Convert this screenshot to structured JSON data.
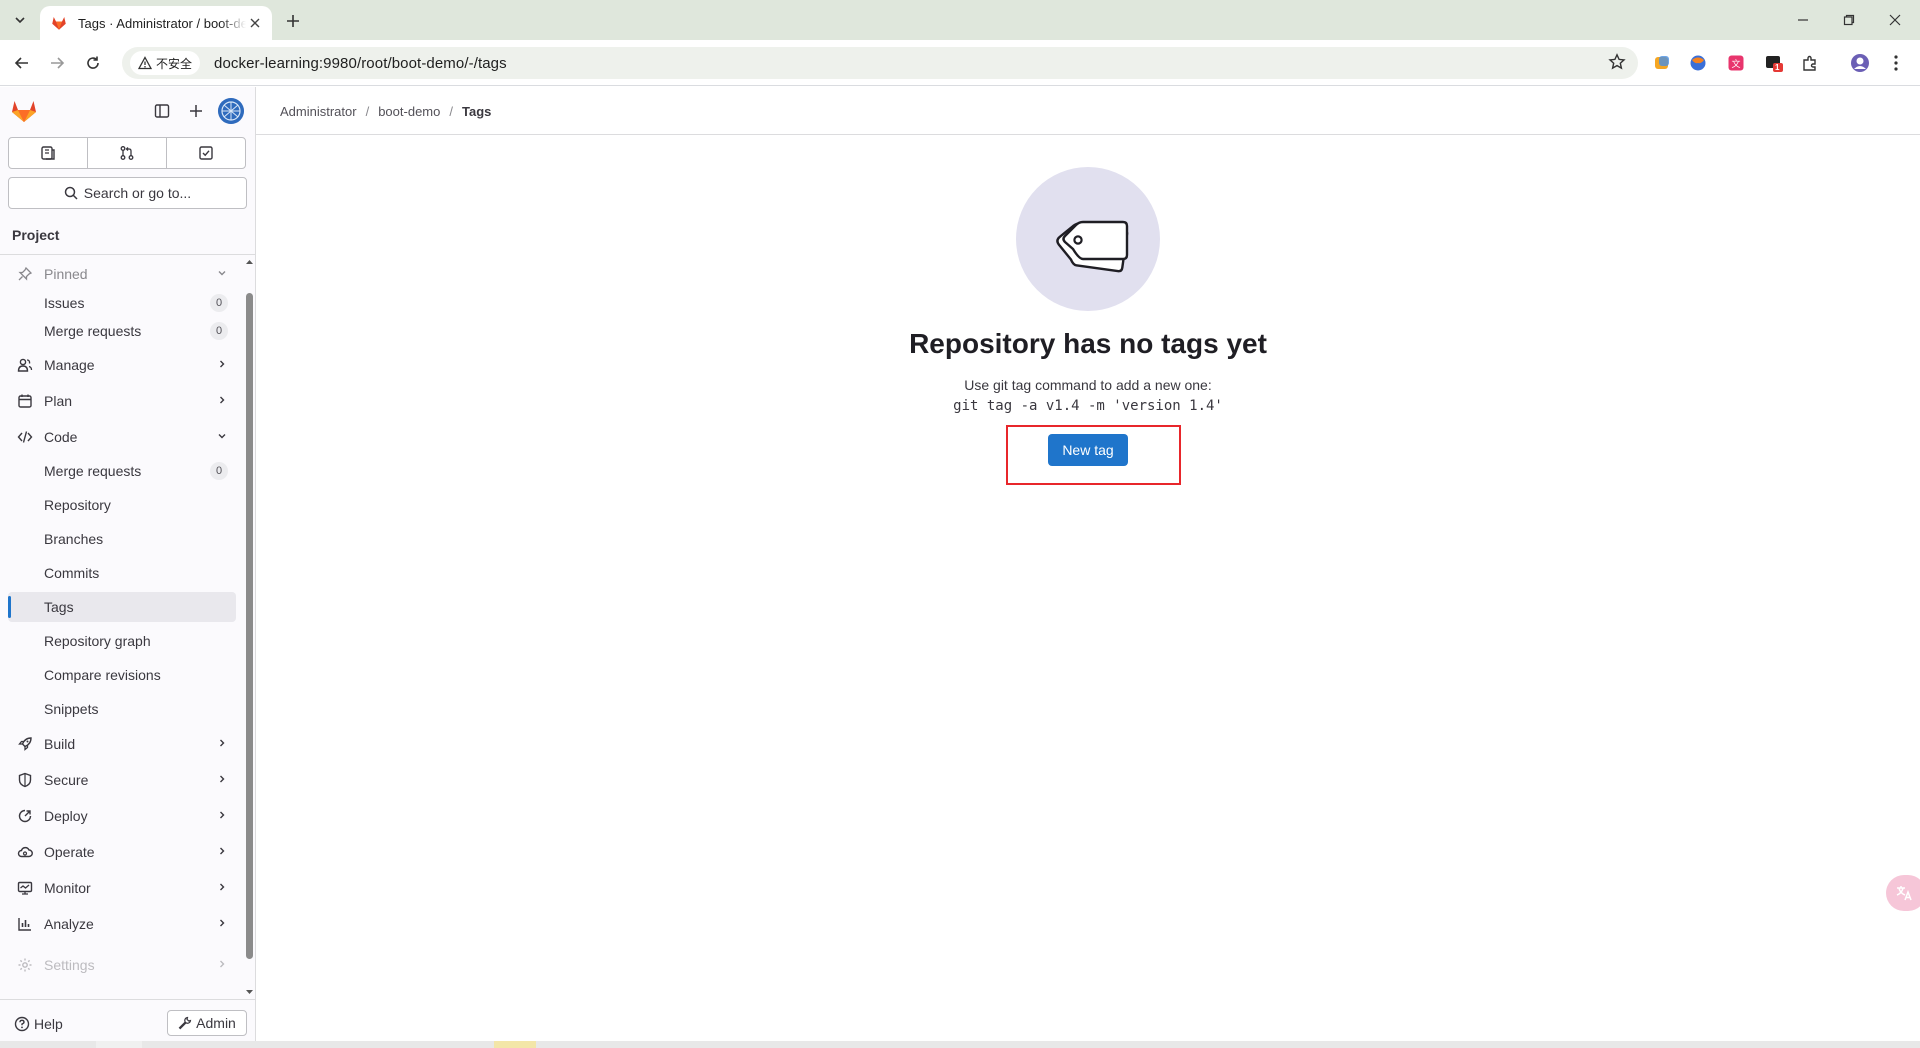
{
  "browser": {
    "tab_title": "Tags · Administrator / boot-demo · GitLab",
    "security_label": "不安全",
    "url": "docker-learning:9980/root/boot-demo/-/tags",
    "extension_badge": "1"
  },
  "sidebar": {
    "search_placeholder": "Search or go to...",
    "context_title": "Project",
    "items": [
      {
        "label": "Pinned",
        "icon": "pin-icon"
      },
      {
        "label": "Issues",
        "count": "0"
      },
      {
        "label": "Merge requests",
        "count": "0"
      },
      {
        "label": "Manage",
        "icon": "users-icon"
      },
      {
        "label": "Plan",
        "icon": "calendar-icon"
      },
      {
        "label": "Code",
        "icon": "code-icon"
      },
      {
        "label": "Merge requests",
        "count": "0"
      },
      {
        "label": "Repository"
      },
      {
        "label": "Branches"
      },
      {
        "label": "Commits"
      },
      {
        "label": "Tags"
      },
      {
        "label": "Repository graph"
      },
      {
        "label": "Compare revisions"
      },
      {
        "label": "Snippets"
      },
      {
        "label": "Build",
        "icon": "rocket-icon"
      },
      {
        "label": "Secure",
        "icon": "shield-icon"
      },
      {
        "label": "Deploy",
        "icon": "deploy-icon"
      },
      {
        "label": "Operate",
        "icon": "cloud-icon"
      },
      {
        "label": "Monitor",
        "icon": "monitor-icon"
      },
      {
        "label": "Analyze",
        "icon": "chart-icon"
      },
      {
        "label": "Settings",
        "icon": "gear-icon"
      }
    ],
    "help_label": "Help",
    "admin_label": "Admin"
  },
  "breadcrumb": [
    "Administrator",
    "boot-demo",
    "Tags"
  ],
  "empty_state": {
    "title": "Repository has no tags yet",
    "description": "Use git tag command to add a new one:",
    "command": "git tag -a v1.4 -m 'version 1.4'",
    "button_label": "New tag"
  },
  "colors": {
    "primary": "#1f75cb",
    "highlight": "#e8262b",
    "illustration_bg": "#e1e0ef"
  }
}
